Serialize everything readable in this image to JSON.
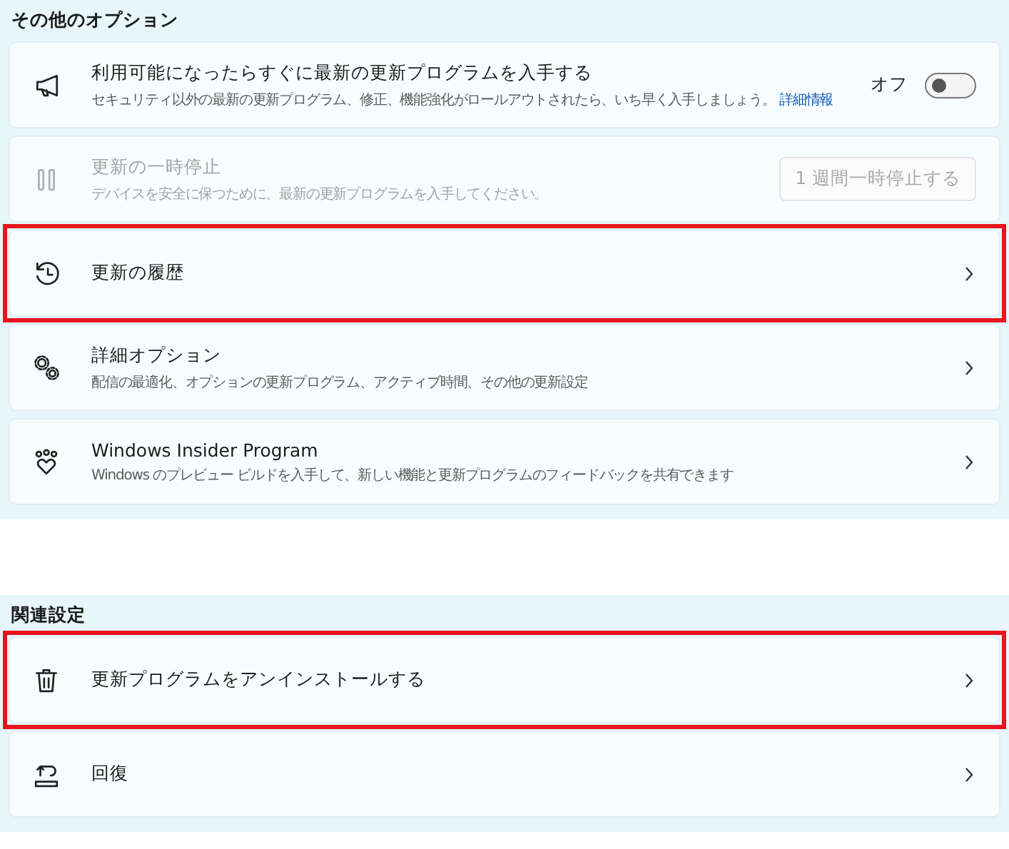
{
  "sections": [
    {
      "title": "その他のオプション",
      "cards": [
        {
          "kind": "toggle",
          "title": "利用可能になったらすぐに最新の更新プログラムを入手する",
          "subtitle": "セキュリティ以外の最新の更新プログラム、修正、機能強化がロールアウトされたら、いち早く入手しましょう。",
          "link": "詳細情報",
          "state_label": "オフ",
          "on": false,
          "disabled": false,
          "highlighted": false
        },
        {
          "kind": "button",
          "title": "更新の一時停止",
          "subtitle": "デバイスを安全に保つために、最新の更新プログラムを入手してください。",
          "button": "1 週間一時停止する",
          "disabled": true,
          "highlighted": false
        },
        {
          "kind": "link",
          "title": "更新の履歴",
          "disabled": false,
          "highlighted": true
        },
        {
          "kind": "link",
          "title": "詳細オプション",
          "subtitle": "配信の最適化、オプションの更新プログラム、アクティブ時間、その他の更新設定",
          "disabled": false,
          "highlighted": false
        },
        {
          "kind": "link",
          "title": "Windows Insider Program",
          "subtitle": "Windows のプレビュー ビルドを入手して、新しい機能と更新プログラムのフィードバックを共有できます",
          "disabled": false,
          "highlighted": false
        }
      ]
    },
    {
      "title": "関連設定",
      "cards": [
        {
          "kind": "link",
          "title": "更新プログラムをアンインストールする",
          "disabled": false,
          "highlighted": true
        },
        {
          "kind": "link",
          "title": "回復",
          "disabled": false,
          "highlighted": false
        }
      ]
    }
  ]
}
